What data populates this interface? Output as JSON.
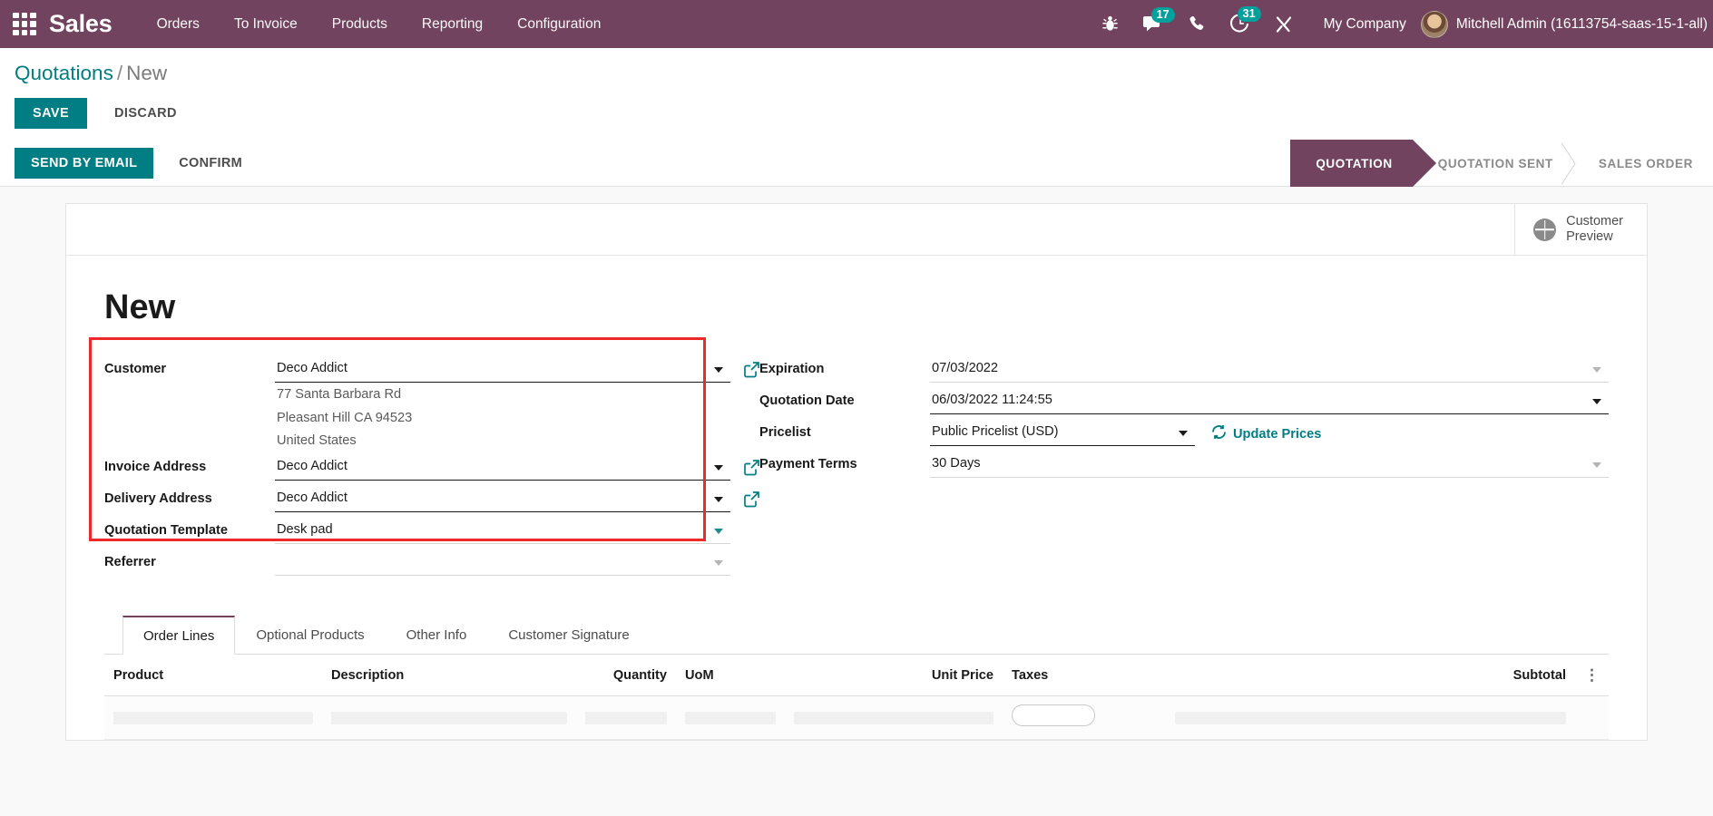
{
  "navbar": {
    "apps_icon": "apps-grid-icon",
    "brand": "Sales",
    "menu": [
      {
        "label": "Orders"
      },
      {
        "label": "To Invoice"
      },
      {
        "label": "Products"
      },
      {
        "label": "Reporting"
      },
      {
        "label": "Configuration"
      }
    ],
    "icons": [
      {
        "name": "bug-icon",
        "badge": ""
      },
      {
        "name": "messages-icon",
        "badge": "17"
      },
      {
        "name": "phone-icon",
        "badge": ""
      },
      {
        "name": "activities-clock-icon",
        "badge": "31"
      },
      {
        "name": "tools-icon",
        "badge": ""
      }
    ],
    "company": "My Company",
    "user_name": "Mitchell Admin (16113754-saas-15-1-all)"
  },
  "breadcrumb": {
    "root": "Quotations",
    "separator": "/",
    "current": "New"
  },
  "record_buttons": {
    "save": "SAVE",
    "discard": "DISCARD"
  },
  "action_bar": {
    "send_by_email": "SEND BY EMAIL",
    "confirm": "CONFIRM"
  },
  "statusbar": {
    "stages": [
      {
        "label": "QUOTATION",
        "active": true
      },
      {
        "label": "QUOTATION SENT",
        "active": false
      },
      {
        "label": "SALES ORDER",
        "active": false
      }
    ]
  },
  "stat_button": {
    "icon": "globe-icon",
    "line1": "Customer",
    "line2": "Preview"
  },
  "form": {
    "title": "New",
    "left": {
      "customer_label": "Customer",
      "customer_value": "Deco Addict",
      "address_lines": [
        "77 Santa Barbara Rd",
        "Pleasant Hill CA 94523",
        "United States"
      ],
      "invoice_address_label": "Invoice Address",
      "invoice_address_value": "Deco Addict",
      "delivery_address_label": "Delivery Address",
      "delivery_address_value": "Deco Addict",
      "quotation_template_label": "Quotation Template",
      "quotation_template_value": "Desk pad",
      "referrer_label": "Referrer",
      "referrer_value": ""
    },
    "right": {
      "expiration_label": "Expiration",
      "expiration_value": "07/03/2022",
      "quotation_date_label": "Quotation Date",
      "quotation_date_value": "06/03/2022 11:24:55",
      "pricelist_label": "Pricelist",
      "pricelist_value": "Public Pricelist (USD)",
      "update_prices_label": "Update Prices",
      "update_prices_icon": "refresh-icon",
      "payment_terms_label": "Payment Terms",
      "payment_terms_value": "30 Days"
    }
  },
  "notebook": {
    "tabs": [
      {
        "label": "Order Lines",
        "active": true
      },
      {
        "label": "Optional Products",
        "active": false
      },
      {
        "label": "Other Info",
        "active": false
      },
      {
        "label": "Customer Signature",
        "active": false
      }
    ],
    "columns": [
      "Product",
      "Description",
      "Quantity",
      "UoM",
      "Unit Price",
      "Taxes",
      "Subtotal"
    ],
    "options_icon": "vertical-dots-icon"
  },
  "colors": {
    "brand_purple": "#71435F",
    "accent_teal": "#017e84",
    "badge_teal": "#00A09D",
    "highlight_red": "#ef2929"
  }
}
